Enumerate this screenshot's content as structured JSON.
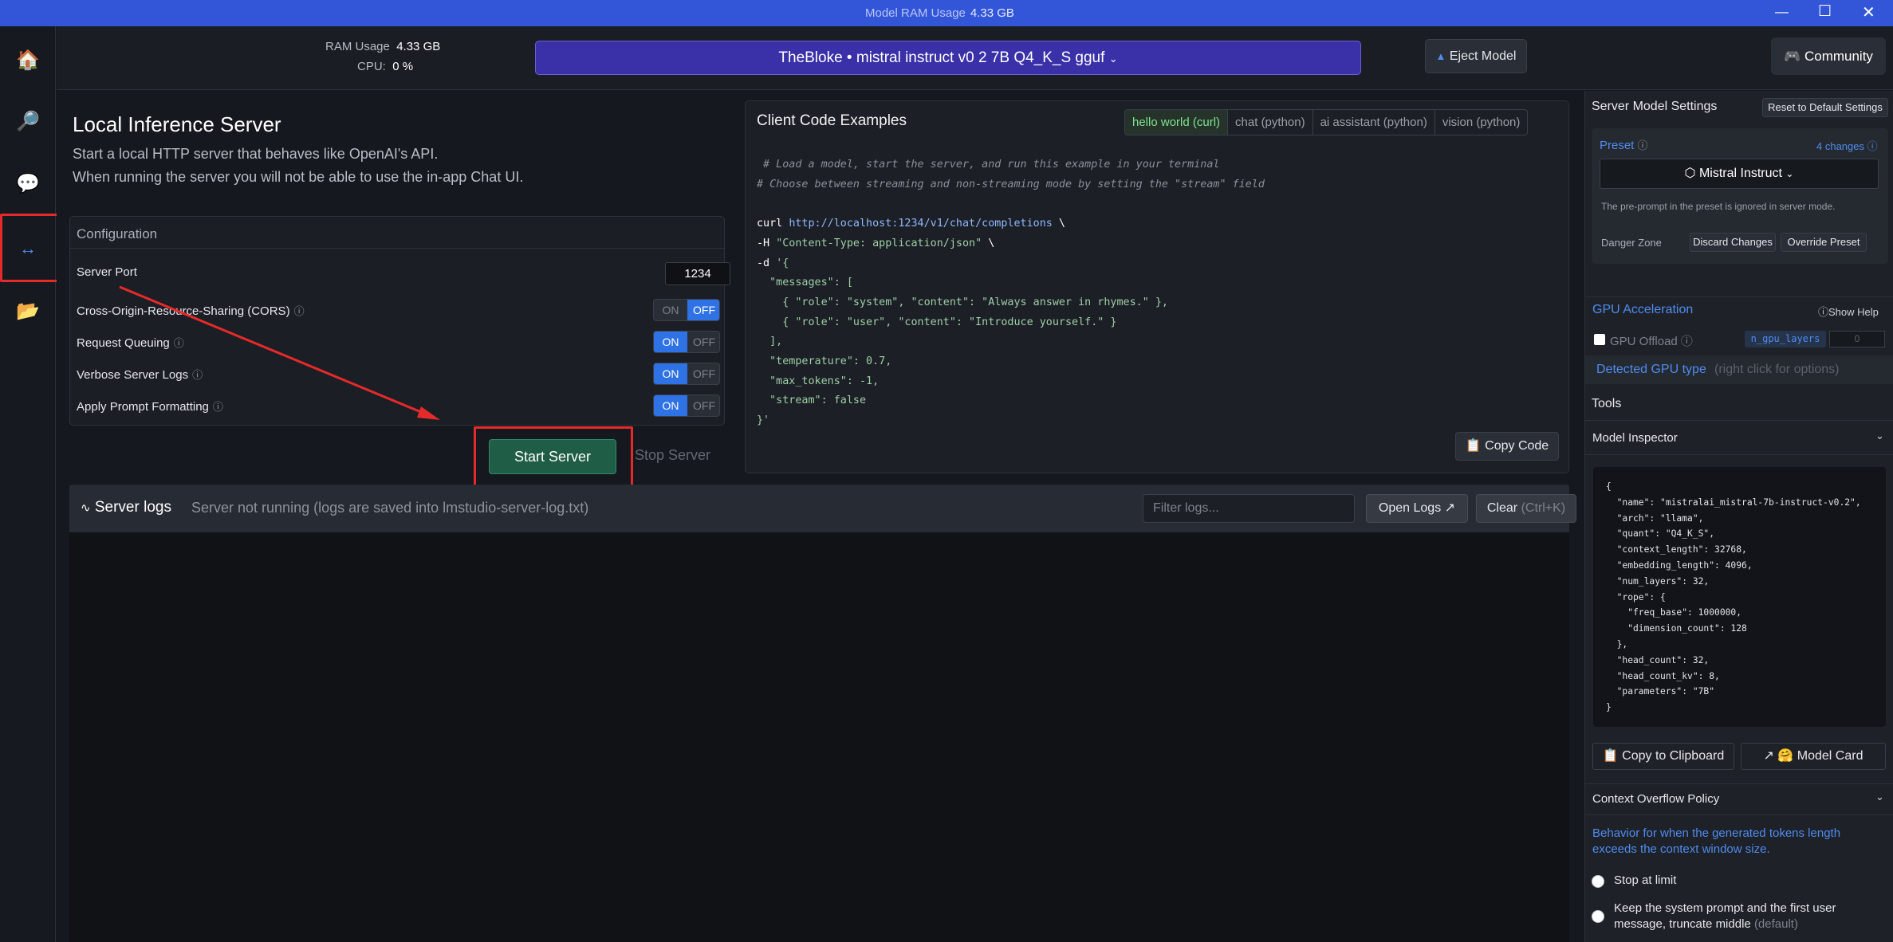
{
  "titlebar": {
    "label": "Model RAM Usage",
    "value": "4.33 GB"
  },
  "topbar": {
    "ram_label": "RAM Usage",
    "ram_value": "4.33 GB",
    "cpu_label": "CPU:",
    "cpu_value": "0 %",
    "model": "TheBloke • mistral instruct v0 2 7B Q4_K_S gguf",
    "eject": "Eject Model",
    "community": "Community"
  },
  "main": {
    "title": "Local Inference Server",
    "desc1": "Start a local HTTP server that behaves like OpenAI's API.",
    "desc2": "When running the server you will not be able to use the in-app Chat UI.",
    "config": {
      "header": "Configuration",
      "port_label": "Server Port",
      "port_value": "1234",
      "cors_label": "Cross-Origin-Resource-Sharing (CORS)",
      "queue_label": "Request Queuing",
      "verbose_label": "Verbose Server Logs",
      "prompt_label": "Apply Prompt Formatting",
      "on": "ON",
      "off": "OFF"
    },
    "start": "Start Server",
    "stop": "Stop Server"
  },
  "code": {
    "title": "Client Code Examples",
    "tabs": [
      "hello world (curl)",
      "chat (python)",
      "ai assistant (python)",
      "vision (python)"
    ],
    "copy": "Copy Code",
    "lines": {
      "l1": " # Load a model, start the server, and run this example in your terminal",
      "l2": "# Choose between streaming and non-streaming mode by setting the \"stream\" field",
      "l3a": "curl ",
      "l3b": "http://localhost:1234/v1/chat/completions",
      " l3c": " \\",
      "l4a": "-H ",
      "l4b": "\"Content-Type: application/json\"",
      " l4c": " \\",
      "l5a": "-d ",
      "l5b": "'{",
      "l6": "  \"messages\": [",
      "l7": "    { \"role\": \"system\", \"content\": \"Always answer in rhymes.\" },",
      "l8": "    { \"role\": \"user\", \"content\": \"Introduce yourself.\" }",
      "l9": "  ],",
      "l10": "  \"temperature\": 0.7,",
      "l11": "  \"max_tokens\": -1,",
      "l12": "  \"stream\": false",
      "l13": "}'"
    }
  },
  "logs": {
    "title": "Server logs",
    "status": "Server not running (logs are saved into lmstudio-server-log.txt)",
    "filter_placeholder": "Filter logs...",
    "open": "Open Logs ↗",
    "clear": "Clear",
    "clear_hint": "(Ctrl+K)"
  },
  "right": {
    "title": "Server Model Settings",
    "reset": "Reset to Default Settings",
    "preset_label": "Preset",
    "changes": "4 changes",
    "preset_value": "Mistral Instruct",
    "preset_note": "The pre-prompt in the preset is ignored in server mode.",
    "danger": "Danger Zone",
    "discard": "Discard Changes",
    "override": "Override Preset",
    "gpu_title": "GPU Acceleration",
    "show_help": "Show Help",
    "gpu_offload": "GPU Offload",
    "n_gpu": "n_gpu_layers",
    "n_gpu_val": "0",
    "detected": "Detected GPU type",
    "detected_hint": "(right click for options)",
    "tools": "Tools",
    "inspector": "Model Inspector",
    "inspector_json": "{\n  \"name\": \"mistralai_mistral-7b-instruct-v0.2\",\n  \"arch\": \"llama\",\n  \"quant\": \"Q4_K_S\",\n  \"context_length\": 32768,\n  \"embedding_length\": 4096,\n  \"num_layers\": 32,\n  \"rope\": {\n    \"freq_base\": 1000000,\n    \"dimension_count\": 128\n  },\n  \"head_count\": 32,\n  \"head_count_kv\": 8,\n  \"parameters\": \"7B\"\n}",
    "copy_clip": "Copy to Clipboard",
    "model_card": "Model Card",
    "overflow": "Context Overflow Policy",
    "overflow_desc": "Behavior for when the generated tokens length exceeds the context window size.",
    "opt1": "Stop at limit",
    "opt2": "Keep the system prompt and the first user message, truncate middle",
    "opt2_hint": "(default)"
  },
  "colors": {
    "accent": "#3356d8",
    "toggle_on": "#2f72e6",
    "start": "#1f5d46",
    "highlight": "#e52a2a"
  }
}
